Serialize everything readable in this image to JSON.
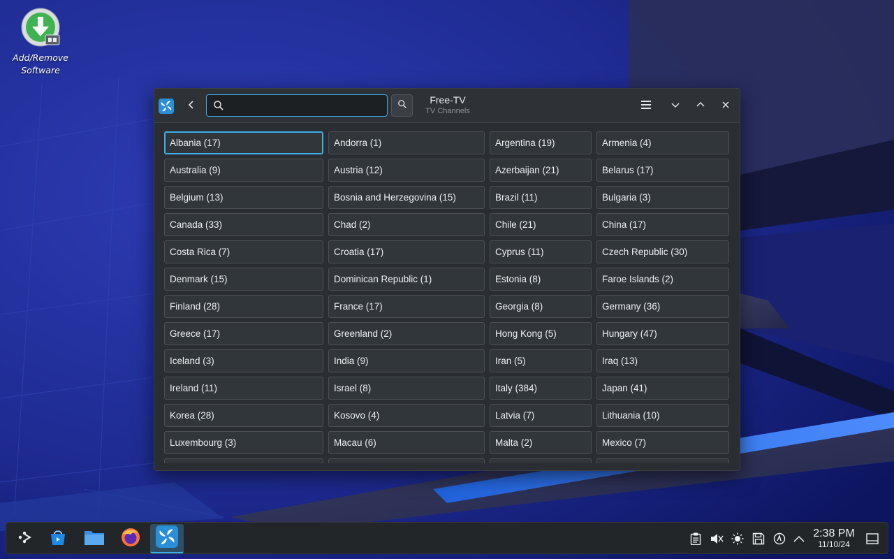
{
  "desktop": {
    "icons": [
      {
        "label": "Add/Remove Software",
        "icon": "software-install-icon"
      }
    ]
  },
  "window": {
    "app_icon": "freetv-logo-icon",
    "back_icon": "chevron-left-icon",
    "search": {
      "value": "",
      "placeholder": ""
    },
    "search_button_icon": "search-icon",
    "title": "Free-TV",
    "subtitle": "TV Channels",
    "menu_icon": "hamburger-menu-icon",
    "minimize_icon": "chevron-down-icon",
    "maximize_icon": "chevron-up-icon",
    "close_icon": "close-icon",
    "countries": [
      "Albania (17)",
      "Andorra (1)",
      "Argentina (19)",
      "Armenia (4)",
      "Australia (9)",
      "Austria (12)",
      "Azerbaijan (21)",
      "Belarus (17)",
      "Belgium (13)",
      "Bosnia and Herzegovina (15)",
      "Brazil (11)",
      "Bulgaria (3)",
      "Canada (33)",
      "Chad (2)",
      "Chile (21)",
      "China (17)",
      "Costa Rica (7)",
      "Croatia (17)",
      "Cyprus (11)",
      "Czech Republic (30)",
      "Denmark (15)",
      "Dominican Republic (1)",
      "Estonia (8)",
      "Faroe Islands (2)",
      "Finland (28)",
      "France (17)",
      "Georgia (8)",
      "Germany (36)",
      "Greece (17)",
      "Greenland (2)",
      "Hong Kong (5)",
      "Hungary (47)",
      "Iceland (3)",
      "India (9)",
      "Iran (5)",
      "Iraq (13)",
      "Ireland (11)",
      "Israel (8)",
      "Italy (384)",
      "Japan (41)",
      "Korea (28)",
      "Kosovo (4)",
      "Latvia (7)",
      "Lithuania (10)",
      "Luxembourg (3)",
      "Macau (6)",
      "Malta (2)",
      "Mexico (7)"
    ],
    "selected_country": "Albania (17)"
  },
  "taskbar": {
    "launcher_icon": "app-launcher-icon",
    "apps": [
      {
        "name": "discover",
        "icon": "discover-store-icon"
      },
      {
        "name": "files",
        "icon": "folder-icon"
      },
      {
        "name": "firefox",
        "icon": "firefox-icon"
      },
      {
        "name": "freetv",
        "icon": "freetv-logo-icon",
        "active": true
      }
    ],
    "tray": [
      "clipboard-icon",
      "volume-muted-icon",
      "brightness-icon",
      "storage-icon",
      "network-icon",
      "show-hidden-icon"
    ],
    "clock": {
      "time": "2:38 PM",
      "date": "11/10/24"
    },
    "show_desktop_icon": "show-desktop-icon"
  },
  "colors": {
    "accent": "#3daee9",
    "window_bg": "#2a2e32",
    "button_bg": "#31363b",
    "taskbar_bg": "#232629"
  }
}
